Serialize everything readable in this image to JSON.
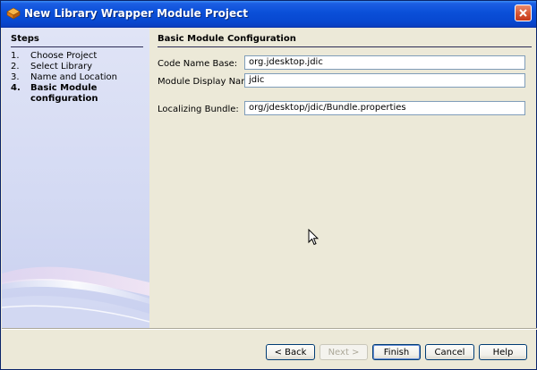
{
  "window": {
    "title": "New Library Wrapper Module Project"
  },
  "steps": {
    "title": "Steps",
    "items": [
      {
        "number": "1.",
        "label": "Choose Project"
      },
      {
        "number": "2.",
        "label": "Select Library"
      },
      {
        "number": "3.",
        "label": "Name and Location"
      },
      {
        "number": "4.",
        "label": "Basic Module configuration"
      }
    ]
  },
  "content": {
    "title": "Basic Module Configuration",
    "fields": {
      "code_name_base": {
        "label": "Code Name Base:",
        "value": "org.jdesktop.jdic"
      },
      "module_display_name": {
        "label": "Module Display Name:",
        "value": "jdic"
      },
      "localizing_bundle": {
        "label": "Localizing Bundle:",
        "value": "org/jdesktop/jdic/Bundle.properties"
      }
    }
  },
  "buttons": {
    "back": "< Back",
    "next": "Next >",
    "finish": "Finish",
    "cancel": "Cancel",
    "help": "Help"
  },
  "icons": {
    "app": "netbeans-module-icon",
    "close": "close-icon",
    "cursor": "mouse-pointer-icon"
  },
  "colors": {
    "titlebar": "#0a4fd8",
    "close_button": "#d5522e",
    "steps_panel": "#d4daf3",
    "dialog_background": "#ece9d8"
  }
}
